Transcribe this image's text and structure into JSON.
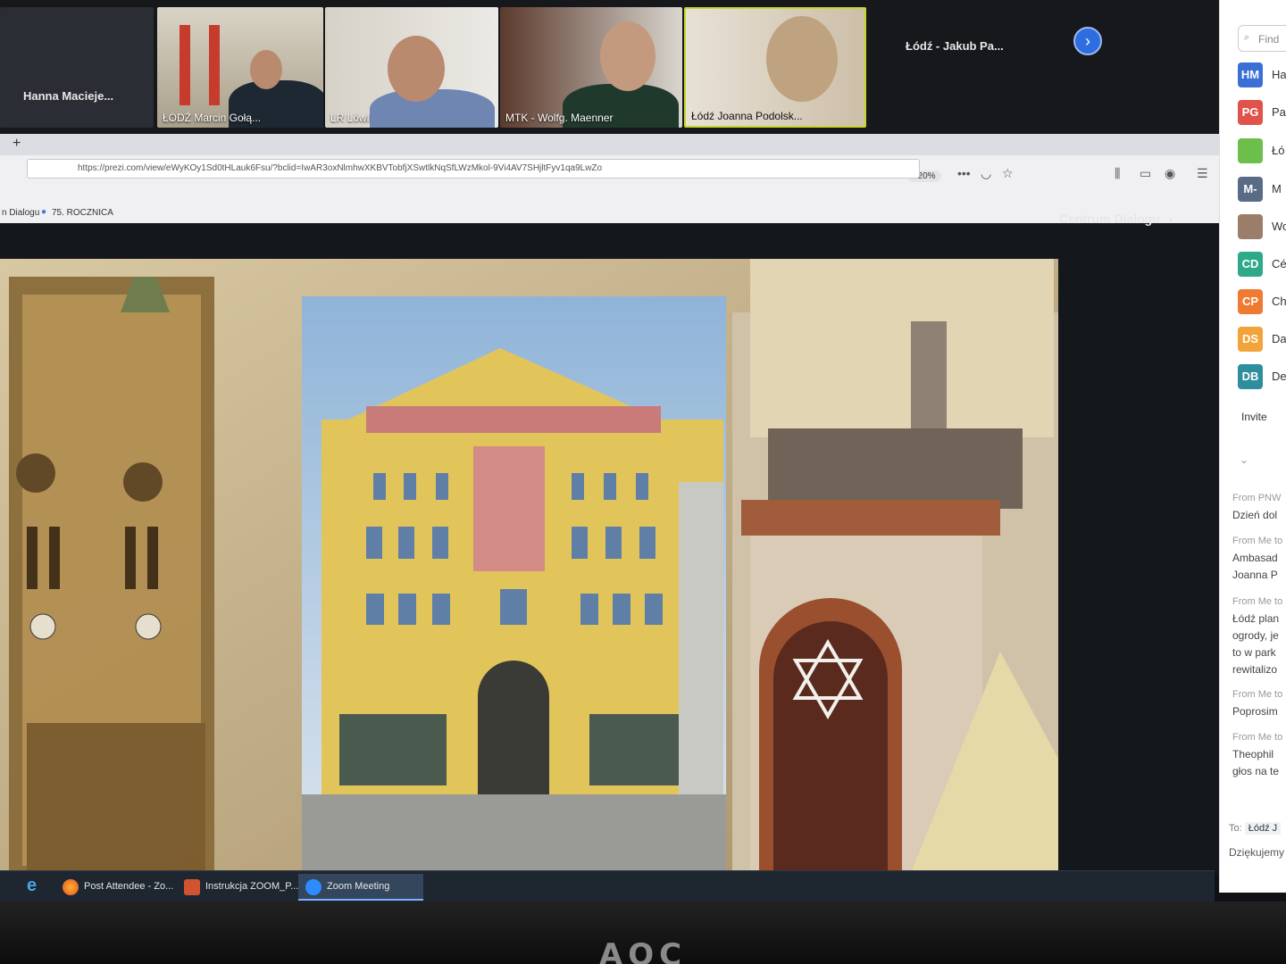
{
  "gallery": {
    "tiles": [
      {
        "name": "Hanna Macieje..."
      },
      {
        "caption": "ŁÓDŹ Marcin Gołą..."
      },
      {
        "caption": "LR Löwl"
      },
      {
        "caption": "MTK - Wolfg. Maenner"
      },
      {
        "caption": "Łódź Joanna Podolsk..."
      },
      {
        "name": "Łódź - Jakub Pa..."
      }
    ],
    "next_icon": "chevron-right-icon"
  },
  "browser": {
    "url": "https://prezi.com/view/eWyKOy1Sd0tHLauk6Fsu/?bclid=IwAR3oxNlmhwXKBVTobfjXSwtlkNqSfLWzMkol-9Vi4AV7SHjltFyv1qa9LwZo",
    "zoom": "120%",
    "bookmarks": [
      "n Dialogu",
      "75. ROCZNICA"
    ],
    "new_tab_icon": "plus-icon"
  },
  "prezi": {
    "owner": "Centrum Dialogu"
  },
  "taskbar": {
    "items": [
      {
        "label": "Post Attendee - Zo..."
      },
      {
        "label": "Instrukcja ZOOM_P..."
      },
      {
        "label": "Zoom Meeting"
      }
    ]
  },
  "panel": {
    "search_placeholder": "Find",
    "participants": [
      {
        "initials": "HM",
        "name": "Ha",
        "color": "#3b6fd6"
      },
      {
        "initials": "PG",
        "name": "Pa",
        "color": "#e0534b"
      },
      {
        "initials": "",
        "name": "Łó",
        "color": "#6cbf4a"
      },
      {
        "initials": "M-",
        "name": "M",
        "color": "#5a6b86"
      },
      {
        "initials": "",
        "name": "Wo",
        "color": "#9b7e6a"
      },
      {
        "initials": "CD",
        "name": "Cé",
        "color": "#2eaa8a"
      },
      {
        "initials": "CP",
        "name": "Ch",
        "color": "#ef7a32"
      },
      {
        "initials": "DS",
        "name": "Da",
        "color": "#f2a33a"
      },
      {
        "initials": "DB",
        "name": "De",
        "color": "#2f8e9e"
      }
    ],
    "invite_label": "Invite",
    "chat": [
      {
        "from": "From PNW",
        "lines": [
          "Dzień dol"
        ]
      },
      {
        "from": "From Me to",
        "lines": [
          "Ambasad",
          "Joanna P"
        ]
      },
      {
        "from": "From Me to",
        "lines": [
          "Łódź plan",
          "ogrody, je",
          "to w park",
          "rewitalizo"
        ]
      },
      {
        "from": "From Me to",
        "lines": [
          "Poprosim"
        ]
      },
      {
        "from": "From Me to",
        "lines": [
          "Theophil",
          "głos na te"
        ]
      }
    ],
    "to_label": "To:",
    "to_value": "Łódź J",
    "compose_text": "Dziękujemy"
  },
  "monitor": {
    "brand": "AOC"
  }
}
